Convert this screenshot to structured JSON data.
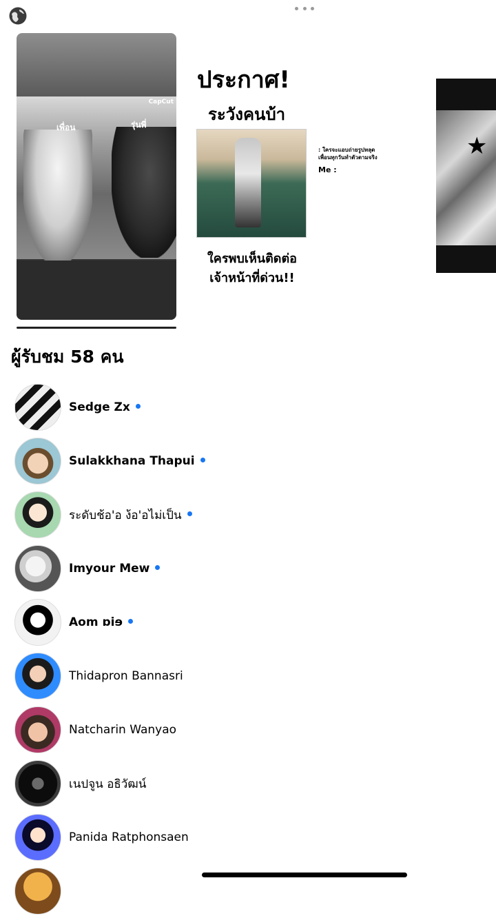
{
  "header": {
    "globe_icon": "globe-icon",
    "more_icon": "more-dots-icon"
  },
  "stories": [
    {
      "tiny_caption": "",
      "watermark": "CapCut",
      "label_left": "เพื่อน",
      "label_right": "รุ่นพี่"
    },
    {
      "headline": "ประกาศ!",
      "subhead": "ระวังคนบ้า",
      "caption_line1": "ใครพบเห็นติดต่อ",
      "caption_line2": "เจ้าหน้าที่ด่วน!!"
    },
    {
      "line1": ": ใครจะแอบถ่ายรูปหลุด",
      "line2": "เพื่อนทุกวันทำตัวตามจริง",
      "line3": "Me :"
    },
    {
      "sticker_icon": "star-icon"
    }
  ],
  "viewers": {
    "heading": "ผู้รับชม 58 คน",
    "list": [
      {
        "name": "Sedge Zx",
        "online": true
      },
      {
        "name": "Sulakkhana Thapui",
        "online": true
      },
      {
        "name": "ระดับช้อ'อ ง้อ'อไม่เป็น",
        "online": true
      },
      {
        "name": "Imyour Mew",
        "online": true
      },
      {
        "name": "Aom ɒiɘ",
        "online": true
      },
      {
        "name": "Thidapron Bannasri",
        "online": false
      },
      {
        "name": "Natcharin Wanyao",
        "online": false
      },
      {
        "name": "เนปจูน อธิวัฒน์",
        "online": false
      },
      {
        "name": "Panida Ratphonsaen",
        "online": false
      }
    ]
  },
  "colors": {
    "online_dot": "#1877f2"
  }
}
